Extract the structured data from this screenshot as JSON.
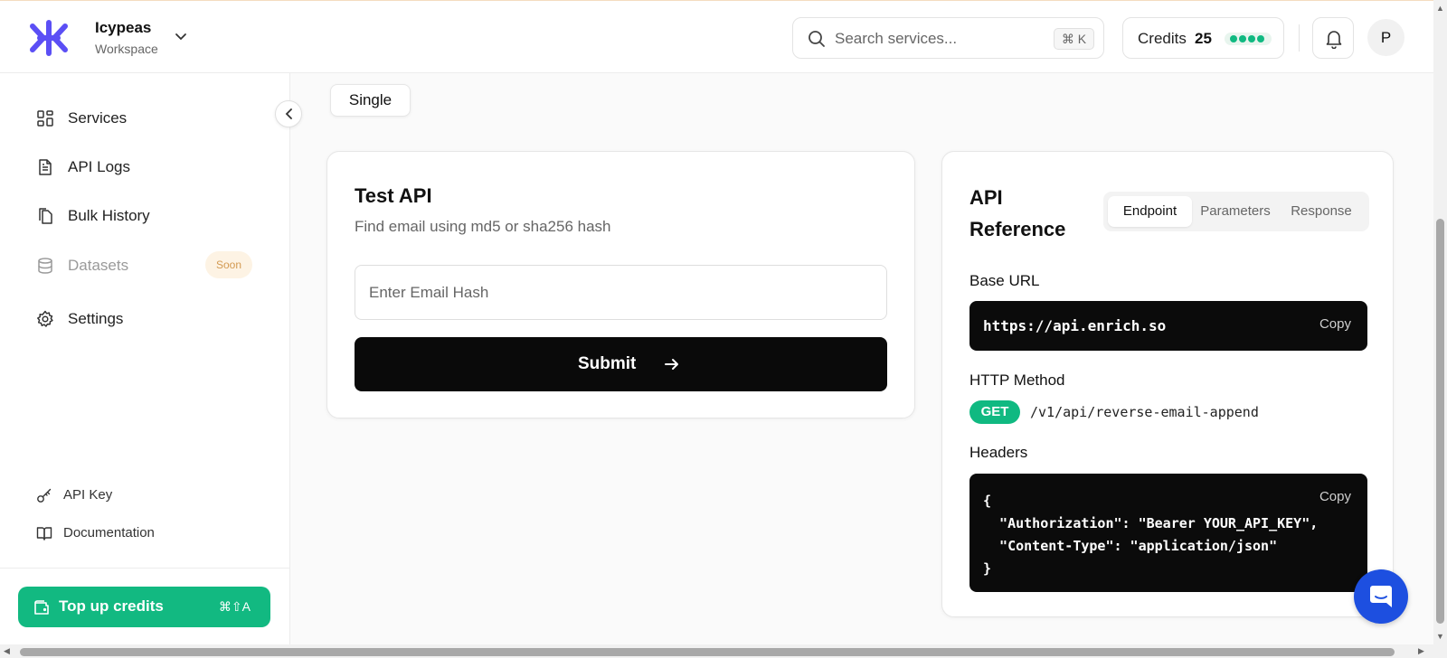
{
  "workspace": {
    "name": "Icypeas",
    "subtitle": "Workspace"
  },
  "search": {
    "placeholder": "Search services...",
    "shortcut": "⌘ K"
  },
  "credits": {
    "label": "Credits",
    "value": "25"
  },
  "user": {
    "initial": "P"
  },
  "sidebar": {
    "items": [
      {
        "label": "Services",
        "icon": "grid-icon"
      },
      {
        "label": "API Logs",
        "icon": "file-text-icon"
      },
      {
        "label": "Bulk History",
        "icon": "files-icon"
      },
      {
        "label": "Datasets",
        "icon": "database-icon",
        "badge": "Soon"
      },
      {
        "label": "Settings",
        "icon": "gear-icon"
      }
    ],
    "bottom_items": [
      {
        "label": "API Key",
        "icon": "key-icon"
      },
      {
        "label": "Documentation",
        "icon": "book-icon"
      }
    ],
    "topup": {
      "label": "Top up credits",
      "shortcut": "⌘⇧A"
    }
  },
  "mode_tab": {
    "label": "Single"
  },
  "test_api": {
    "title": "Test API",
    "subtitle": "Find email using md5 or sha256 hash",
    "input_placeholder": "Enter Email Hash",
    "submit_label": "Submit"
  },
  "api_reference": {
    "title": "API Reference",
    "tabs": [
      "Endpoint",
      "Parameters",
      "Response"
    ],
    "active_tab": "Endpoint",
    "base_url_label": "Base URL",
    "base_url": "https://api.enrich.so",
    "copy_label": "Copy",
    "http_method_label": "HTTP Method",
    "method": "GET",
    "endpoint_path": "/v1/api/reverse-email-append",
    "headers_label": "Headers",
    "headers_code": "{\n  \"Authorization\": \"Bearer YOUR_API_KEY\",\n  \"Content-Type\": \"application/json\"\n}"
  },
  "colors": {
    "accent_green": "#10b981",
    "brand_purple": "#5b4ff5",
    "chat_blue": "#1d4fe0",
    "code_bg": "#0b0b0b"
  }
}
